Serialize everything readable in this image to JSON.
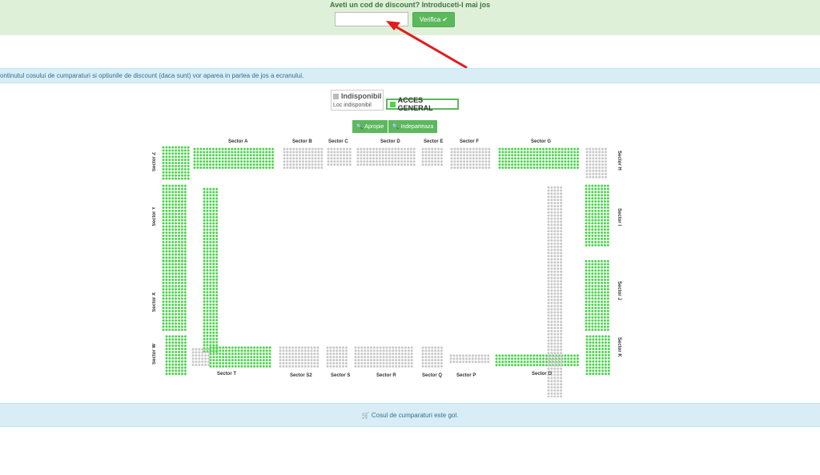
{
  "discount": {
    "prompt": "Aveti un cod de discount? Introduceti-l mai jos",
    "input_value": "",
    "verify_label": "Verifica ✔"
  },
  "info": {
    "text": "ontinutul cosului de cumparaturi si optiunile de discount (daca sunt) vor aparea in partea de jos a ecranului."
  },
  "legend": {
    "unavailable_label": "Indisponibil",
    "unavailable_sub": "Loc indisponibil",
    "general_label": "ACCES GENERAL"
  },
  "zoom": {
    "zoom_in_label": "Apropie",
    "zoom_out_label": "Indeparteaza"
  },
  "sectors": {
    "a": "Sector A",
    "b": "Sector B",
    "c": "Sector C",
    "d": "Sector D",
    "e": "Sector E",
    "f": "Sector F",
    "g": "Sector G",
    "h": "Sector H",
    "i": "Sector I",
    "j": "Sector J",
    "k": "Sector K",
    "o": "Sector O",
    "p": "Sector P",
    "q": "Sector Q",
    "r": "Sector R",
    "s": "Sector S",
    "s2": "Sector S2",
    "t": "Sector T",
    "w": "Sector W",
    "x": "Sector X",
    "y": "Sector Y",
    "z": "Sector Z"
  },
  "cart": {
    "empty_text": "Cosul de cumparaturi este gol."
  },
  "colors": {
    "available": "#4cd44c",
    "unavailable": "#c8c8c8",
    "button": "#5cb85c"
  }
}
